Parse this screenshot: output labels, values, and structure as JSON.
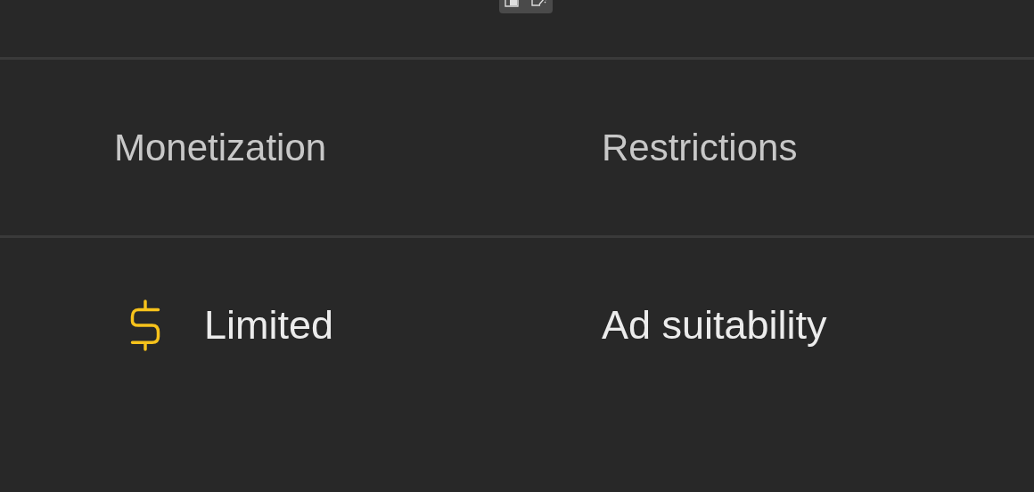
{
  "table": {
    "columns": [
      "Monetization",
      "Restrictions"
    ],
    "rows": [
      {
        "monetization": "Limited",
        "restrictions": "Ad suitability"
      }
    ]
  }
}
